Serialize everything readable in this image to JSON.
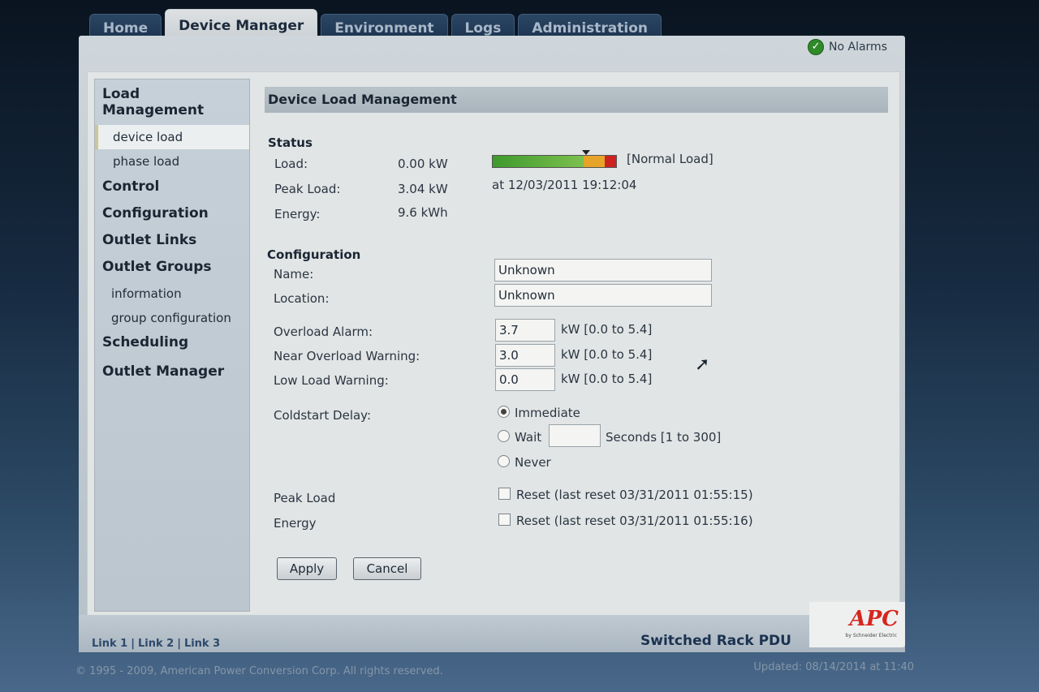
{
  "tabs": [
    "Home",
    "Device Manager",
    "Environment",
    "Logs",
    "Administration"
  ],
  "alarm_status": "No Alarms",
  "sidebar": {
    "load_management": "Load Management",
    "device_load": "device load",
    "phase_load": "phase load",
    "control": "Control",
    "configuration": "Configuration",
    "outlet_links": "Outlet Links",
    "outlet_groups": "Outlet Groups",
    "information": "information",
    "group_configuration": "group configuration",
    "scheduling": "Scheduling",
    "outlet_manager": "Outlet Manager"
  },
  "panel_title": "Device Load Management",
  "status": {
    "heading": "Status",
    "load_label": "Load:",
    "load_value": "0.00 kW",
    "load_state": "[Normal Load]",
    "load_meter_fraction": 0.75,
    "peak_label": "Peak Load:",
    "peak_value": "3.04 kW",
    "peak_time": "at 12/03/2011 19:12:04",
    "energy_label": "Energy:",
    "energy_value": "9.6 kWh"
  },
  "config": {
    "heading": "Configuration",
    "name_label": "Name:",
    "name_value": "Unknown",
    "location_label": "Location:",
    "location_value": "Unknown",
    "overload_label": "Overload Alarm:",
    "overload_value": "3.7",
    "overload_range": "kW [0.0 to 5.4]",
    "near_label": "Near Overload Warning:",
    "near_value": "3.0",
    "near_range": "kW [0.0 to 5.4]",
    "low_label": "Low Load Warning:",
    "low_value": "0.0",
    "low_range": "kW [0.0 to 5.4]",
    "coldstart_label": "Coldstart Delay:",
    "immediate": "Immediate",
    "wait": "Wait",
    "wait_value": "",
    "wait_range": "Seconds [1 to 300]",
    "never": "Never",
    "peak_reset_label": "Peak Load",
    "peak_reset_text": "Reset (last reset 03/31/2011 01:55:15)",
    "energy_reset_label": "Energy",
    "energy_reset_text": "Reset (last reset 03/31/2011 01:55:16)"
  },
  "buttons": {
    "apply": "Apply",
    "cancel": "Cancel"
  },
  "footer": {
    "link1": "Link 1",
    "link2": "Link 2",
    "link3": "Link 3",
    "product": "Switched Rack PDU",
    "logo": "APC",
    "logo_sub": "by Schneider Electric",
    "copyright": "© 1995 - 2009, American Power Conversion Corp. All rights reserved.",
    "updated": "Updated: 08/14/2014 at 11:40"
  },
  "colors": {
    "meter_green": "#3e9a2d",
    "meter_orange": "#e6a52a",
    "meter_red": "#cc2222",
    "logo": "#d6261e"
  }
}
